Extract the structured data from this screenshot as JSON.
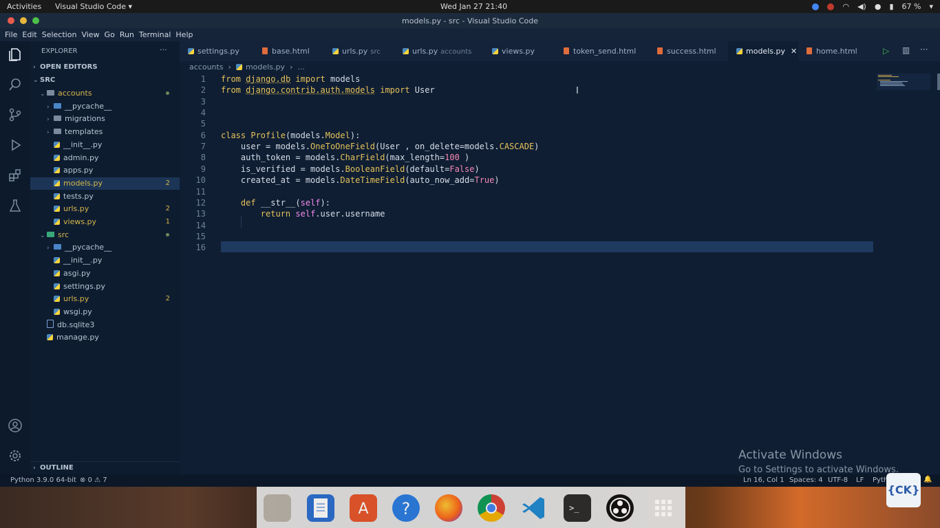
{
  "topbar": {
    "activities": "Activities",
    "app": "Visual Studio Code",
    "clock": "Wed Jan 27  21:40",
    "battery": "67 %"
  },
  "window": {
    "title": "models.py - src - Visual Studio Code"
  },
  "menu": [
    "File",
    "Edit",
    "Selection",
    "View",
    "Go",
    "Run",
    "Terminal",
    "Help"
  ],
  "activity_icons": [
    "explorer-icon",
    "search-icon",
    "source-control-icon",
    "run-debug-icon",
    "extensions-icon",
    "testing-icon",
    "account-icon",
    "manage-gear-icon"
  ],
  "sidebar": {
    "header": "EXPLORER",
    "more": "···",
    "open_editors": "OPEN EDITORS",
    "root": "SRC",
    "outline": "OUTLINE",
    "tree": [
      {
        "label": "accounts",
        "kind": "folder-open",
        "depth": 1
      },
      {
        "label": "__pycache__",
        "kind": "folder-blue",
        "depth": 2
      },
      {
        "label": "migrations",
        "kind": "folder",
        "depth": 2
      },
      {
        "label": "templates",
        "kind": "folder",
        "depth": 2
      },
      {
        "label": "__init__.py",
        "kind": "py",
        "depth": 2
      },
      {
        "label": "admin.py",
        "kind": "py",
        "depth": 2
      },
      {
        "label": "apps.py",
        "kind": "py",
        "depth": 2
      },
      {
        "label": "models.py",
        "kind": "py",
        "depth": 2,
        "badge": "2",
        "selected": true
      },
      {
        "label": "tests.py",
        "kind": "py",
        "depth": 2
      },
      {
        "label": "urls.py",
        "kind": "py",
        "depth": 2,
        "badge": "2"
      },
      {
        "label": "views.py",
        "kind": "py",
        "depth": 2,
        "badge": "1"
      },
      {
        "label": "src",
        "kind": "folder-green",
        "depth": 1
      },
      {
        "label": "__pycache__",
        "kind": "folder-blue",
        "depth": 2
      },
      {
        "label": "__init__.py",
        "kind": "py",
        "depth": 2
      },
      {
        "label": "asgi.py",
        "kind": "py",
        "depth": 2
      },
      {
        "label": "settings.py",
        "kind": "py",
        "depth": 2
      },
      {
        "label": "urls.py",
        "kind": "py",
        "depth": 2,
        "badge": "2"
      },
      {
        "label": "wsgi.py",
        "kind": "py",
        "depth": 2
      },
      {
        "label": "db.sqlite3",
        "kind": "db",
        "depth": 1
      },
      {
        "label": "manage.py",
        "kind": "py",
        "depth": 1
      }
    ]
  },
  "tabs": [
    {
      "label": "settings.py",
      "kind": "py"
    },
    {
      "label": "base.html",
      "kind": "html"
    },
    {
      "label": "urls.py",
      "sub": "src",
      "kind": "py"
    },
    {
      "label": "urls.py",
      "sub": "accounts",
      "kind": "py"
    },
    {
      "label": "views.py",
      "kind": "py"
    },
    {
      "label": "token_send.html",
      "kind": "html"
    },
    {
      "label": "success.html",
      "kind": "html"
    },
    {
      "label": "models.py",
      "kind": "py",
      "active": true
    },
    {
      "label": "home.html",
      "kind": "html"
    }
  ],
  "breadcrumb": [
    "accounts",
    "models.py",
    "..."
  ],
  "code_lines": [
    "from django.db import models",
    "from django.contrib.auth.models import User",
    "",
    "",
    "",
    "class Profile(models.Model):",
    "    user = models.OneToOneField(User , on_delete=models.CASCADE)",
    "    auth_token = models.CharField(max_length=100 )",
    "    is_verified = models.BooleanField(default=False)",
    "    created_at = models.DateTimeField(auto_now_add=True)",
    "",
    "    def __str__(self):",
    "        return self.user.username",
    "",
    "",
    ""
  ],
  "status": {
    "python": "Python 3.9.0 64-bit",
    "problems": "⊗ 0 ⚠ 7",
    "position": "Ln 16, Col 1",
    "spaces": "Spaces: 4",
    "encoding": "UTF-8",
    "eol": "LF",
    "language": "Python"
  },
  "watermark": {
    "title": "Activate Windows",
    "subtitle": "Go to Settings to activate Windows."
  },
  "dock": [
    "files-icon",
    "text-editor-icon",
    "app-store-icon",
    "help-icon",
    "firefox-icon",
    "chrome-icon",
    "vscode-icon",
    "terminal-icon",
    "obs-icon",
    "app-grid-icon"
  ]
}
